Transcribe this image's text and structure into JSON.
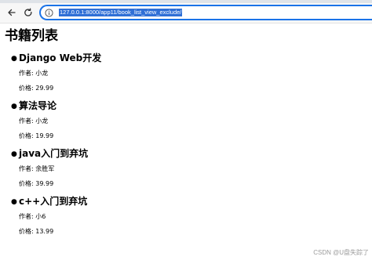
{
  "browser": {
    "url": "127.0.0.1:8000/app11/book_list_view_exclude/"
  },
  "page": {
    "title": "书籍列表",
    "author_prefix": "作者: ",
    "price_prefix": "价格: ",
    "books": [
      {
        "title": "Django Web开发",
        "author": "小龙",
        "price": "29.99"
      },
      {
        "title": "算法导论",
        "author": "小龙",
        "price": "19.99"
      },
      {
        "title": "java入门到弃坑",
        "author": "余胜军",
        "price": "39.99"
      },
      {
        "title": "c++入门到弃坑",
        "author": "小6",
        "price": "13.99"
      }
    ]
  },
  "watermark": "CSDN @U盘失踪了",
  "icons": {
    "back": "back-arrow-icon",
    "reload": "reload-icon",
    "info": "info-icon"
  },
  "colors": {
    "address_border": "#1a73e8",
    "url_selection": "#2f6fd6"
  }
}
